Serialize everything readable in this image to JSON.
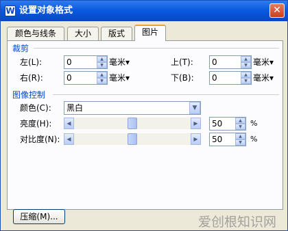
{
  "window": {
    "title": "设置对象格式",
    "icon_letter": "W"
  },
  "tabs": [
    "颜色与线条",
    "大小",
    "版式",
    "图片"
  ],
  "crop": {
    "title": "裁剪",
    "left": {
      "label": "左(L):",
      "value": "0",
      "unit": "毫米▾"
    },
    "right": {
      "label": "右(R):",
      "value": "0",
      "unit": "毫米▾"
    },
    "top": {
      "label": "上(T):",
      "value": "0",
      "unit": "毫米▾"
    },
    "bottom": {
      "label": "下(B):",
      "value": "0",
      "unit": "毫米▾"
    }
  },
  "image_control": {
    "title": "图像控制",
    "color": {
      "label": "颜色(C):",
      "value": "黑白"
    },
    "brightness": {
      "label": "亮度(H):",
      "value": "50",
      "unit": "%"
    },
    "contrast": {
      "label": "对比度(N):",
      "value": "50",
      "unit": "%"
    }
  },
  "compress_label": "压缩(M)...",
  "watermark_text": "爱创根知识网"
}
